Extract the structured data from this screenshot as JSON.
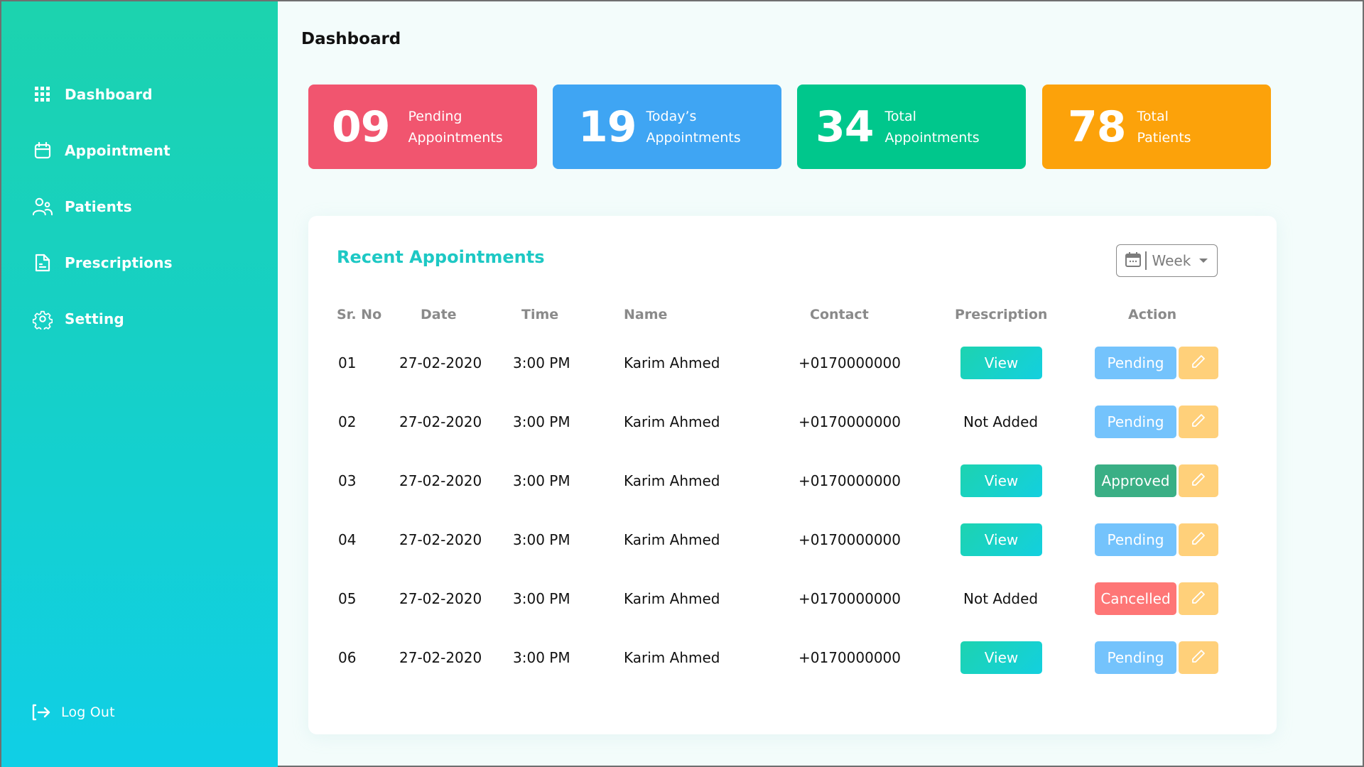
{
  "sidebar": {
    "items": [
      {
        "label": "Dashboard",
        "icon": "grid-icon"
      },
      {
        "label": "Appointment",
        "icon": "calendar-icon"
      },
      {
        "label": "Patients",
        "icon": "users-icon"
      },
      {
        "label": "Prescriptions",
        "icon": "document-icon"
      },
      {
        "label": "Setting",
        "icon": "gear-icon"
      }
    ],
    "logout": {
      "label": "Log Out",
      "icon": "logout-icon"
    }
  },
  "header": {
    "title": "Dashboard"
  },
  "stats": [
    {
      "value": "09",
      "line1": "Pending",
      "line2": "Appointments",
      "color": "#f1556f"
    },
    {
      "value": "19",
      "line1": "Today’s",
      "line2": "Appointments",
      "color": "#3fa5f3"
    },
    {
      "value": "34",
      "line1": "Total",
      "line2": "Appointments",
      "color": "#00c78c"
    },
    {
      "value": "78",
      "line1": "Total",
      "line2": "Patients",
      "color": "#fca20a"
    }
  ],
  "recent": {
    "title": "Recent Appointments",
    "filter": {
      "selected": "Week",
      "icon": "calendar-icon"
    },
    "columns": [
      "Sr. No",
      "Date",
      "Time",
      "Name",
      "Contact",
      "Prescription",
      "Action"
    ],
    "rows": [
      {
        "sr": "01",
        "date": "27-02-2020",
        "time": "3:00 PM",
        "name": "Karim Ahmed",
        "contact": "+0170000000",
        "prescription": "View",
        "status": "Pending"
      },
      {
        "sr": "02",
        "date": "27-02-2020",
        "time": "3:00 PM",
        "name": "Karim Ahmed",
        "contact": "+0170000000",
        "prescription": "Not Added",
        "status": "Pending"
      },
      {
        "sr": "03",
        "date": "27-02-2020",
        "time": "3:00 PM",
        "name": "Karim Ahmed",
        "contact": "+0170000000",
        "prescription": "View",
        "status": "Approved"
      },
      {
        "sr": "04",
        "date": "27-02-2020",
        "time": "3:00 PM",
        "name": "Karim Ahmed",
        "contact": "+0170000000",
        "prescription": "View",
        "status": "Pending"
      },
      {
        "sr": "05",
        "date": "27-02-2020",
        "time": "3:00 PM",
        "name": "Karim Ahmed",
        "contact": "+0170000000",
        "prescription": "Not Added",
        "status": "Cancelled"
      },
      {
        "sr": "06",
        "date": "27-02-2020",
        "time": "3:00 PM",
        "name": "Karim Ahmed",
        "contact": "+0170000000",
        "prescription": "View",
        "status": "Pending"
      }
    ],
    "status_colors": {
      "Pending": "#74c3fc",
      "Approved": "#3aaf85",
      "Cancelled": "#fe7676"
    },
    "edit_icon": "pencil-icon"
  }
}
